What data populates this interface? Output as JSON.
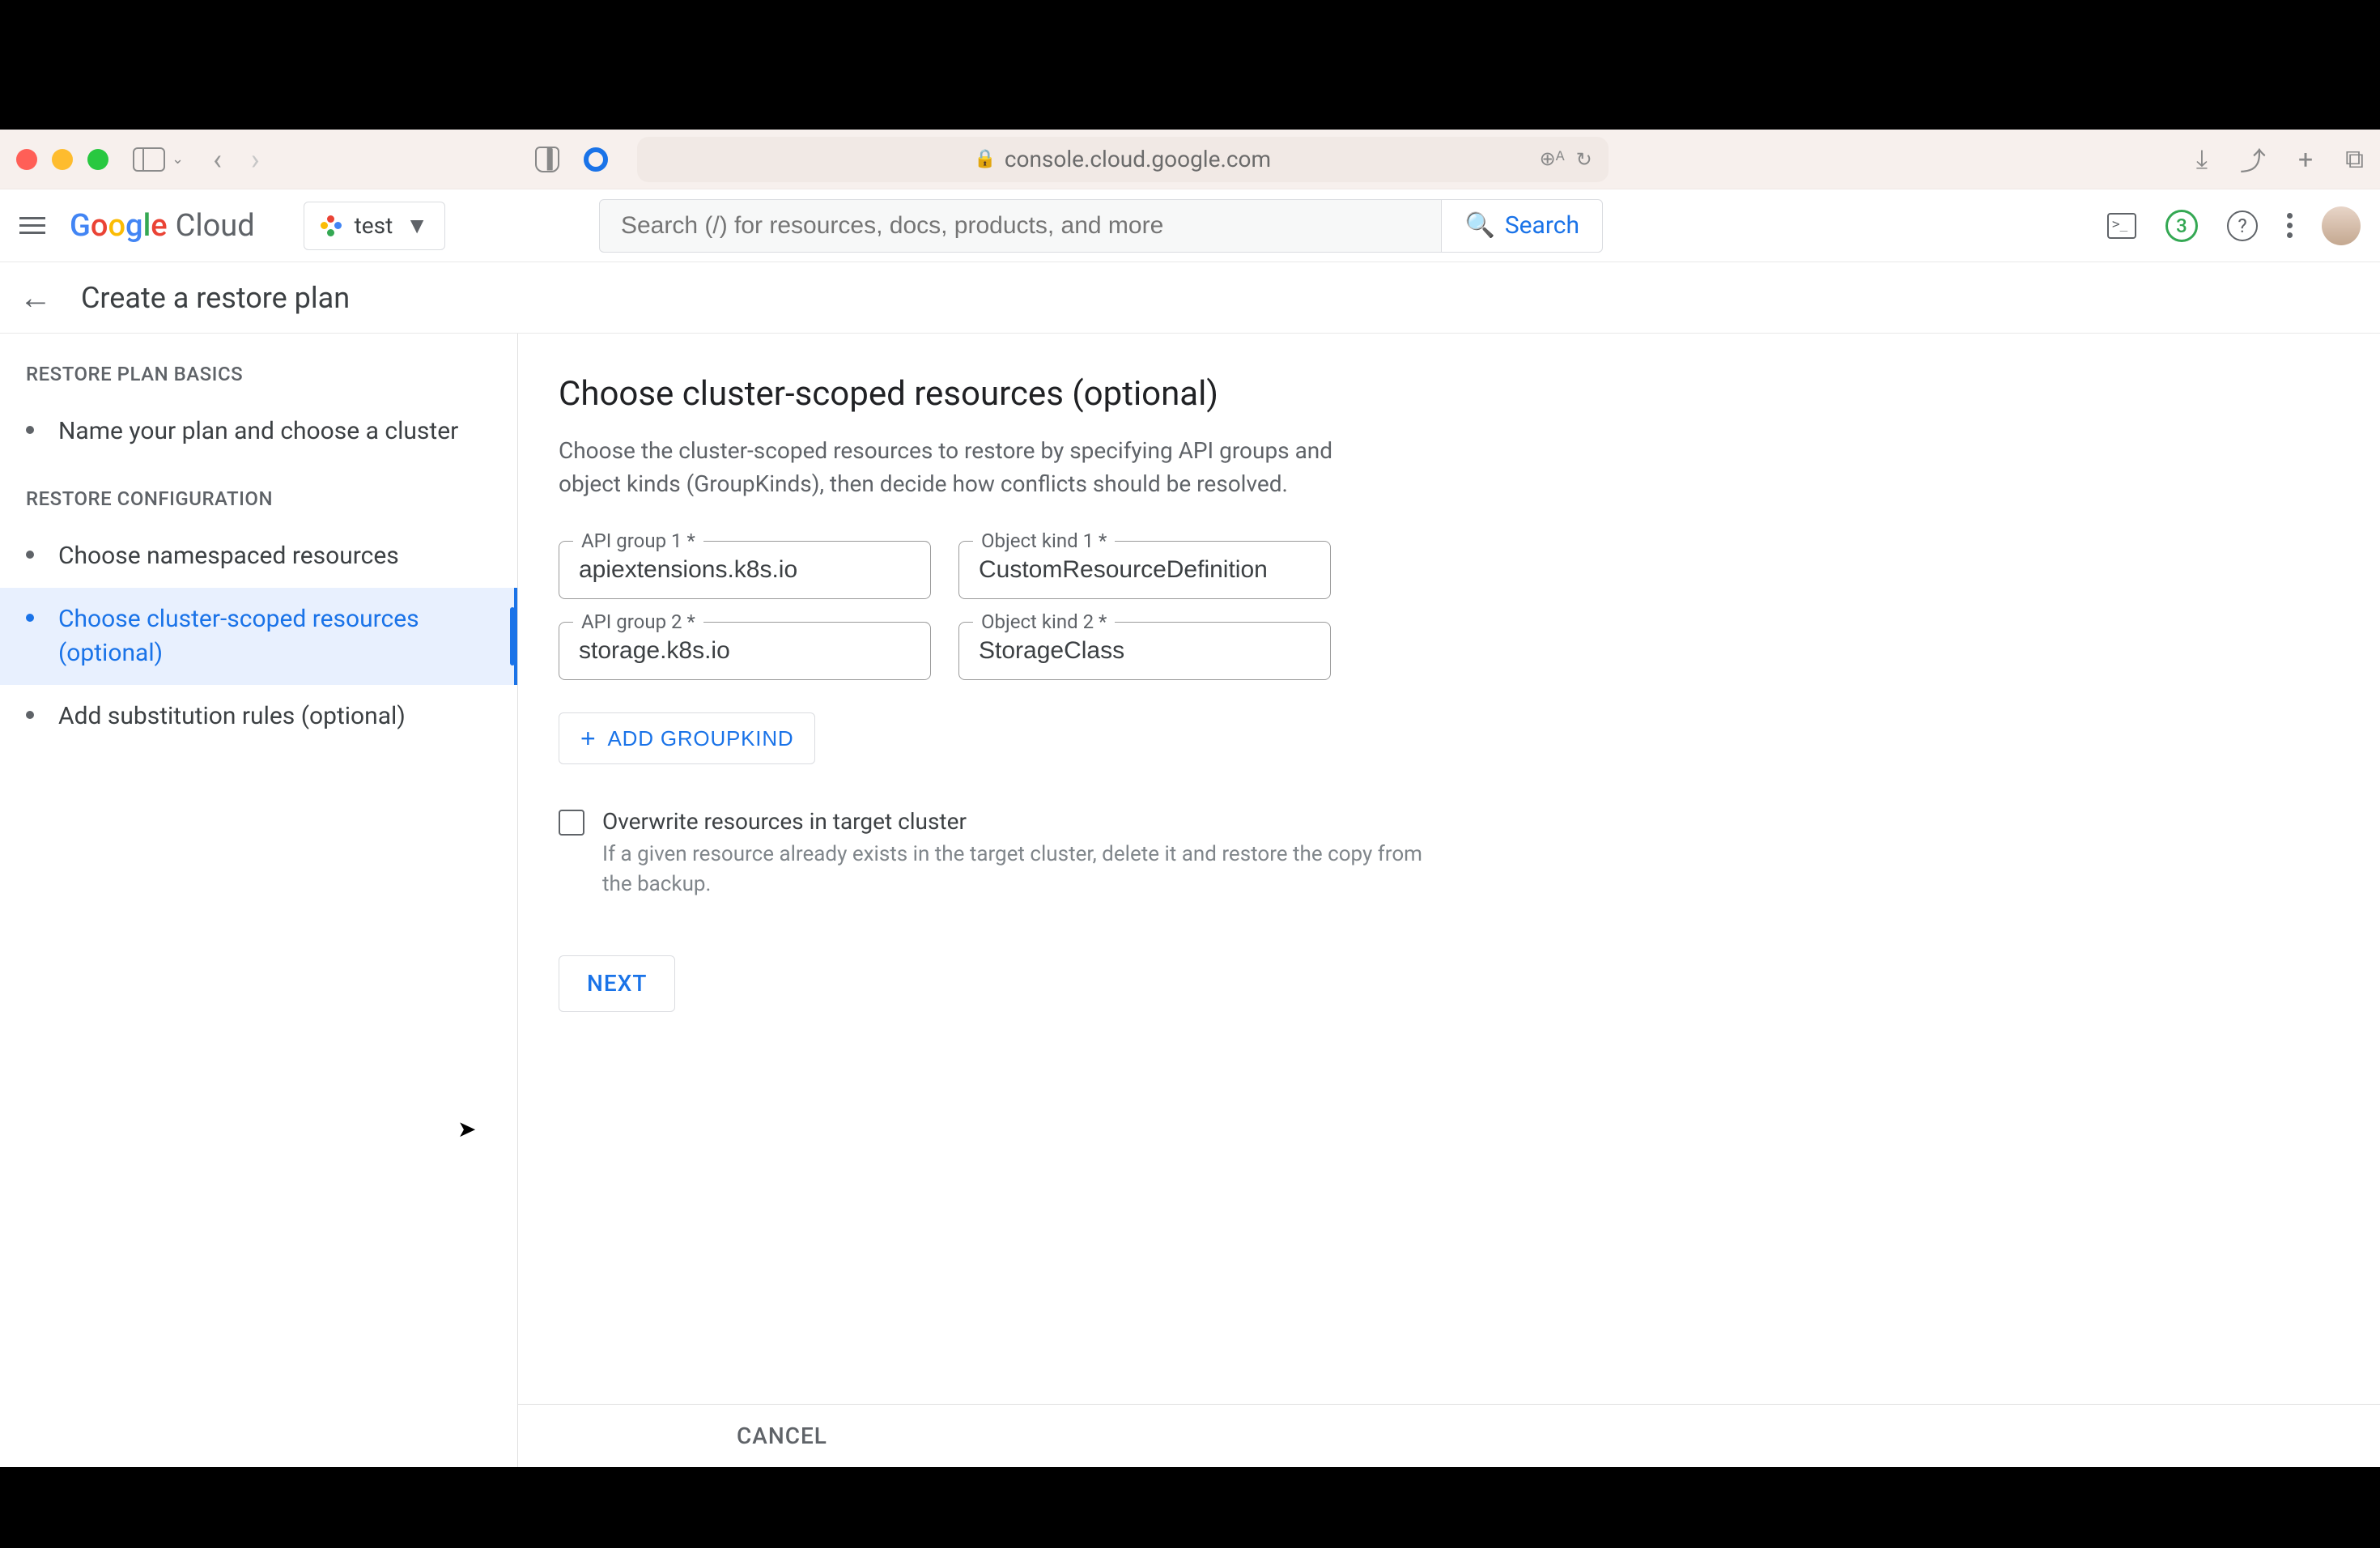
{
  "browser": {
    "url": "console.cloud.google.com"
  },
  "header": {
    "logo_text": "Google Cloud",
    "project": "test",
    "search_placeholder": "Search (/) for resources, docs, products, and more",
    "search_btn": "Search",
    "badge": "3"
  },
  "subheader": {
    "title": "Create a restore plan"
  },
  "sidebar": {
    "section1": "RESTORE PLAN BASICS",
    "section2": "RESTORE CONFIGURATION",
    "items": [
      "Name your plan and choose a cluster",
      "Choose namespaced resources",
      "Choose cluster-scoped resources (optional)",
      "Add substitution rules (optional)"
    ]
  },
  "main": {
    "heading": "Choose cluster-scoped resources (optional)",
    "description": "Choose the cluster-scoped resources to restore by specifying API groups and object kinds (GroupKinds), then decide how conflicts should be resolved.",
    "fields": {
      "api1_label": "API group 1 *",
      "api1_value": "apiextensions.k8s.io",
      "kind1_label": "Object kind 1 *",
      "kind1_value": "CustomResourceDefinition",
      "api2_label": "API group 2 *",
      "api2_value": "storage.k8s.io",
      "kind2_label": "Object kind 2 *",
      "kind2_value": "StorageClass"
    },
    "add_btn": "ADD GROUPKIND",
    "checkbox": {
      "label": "Overwrite resources in target cluster",
      "help": "If a given resource already exists in the target cluster, delete it and restore the copy from the backup."
    },
    "next_btn": "NEXT",
    "cancel_btn": "CANCEL"
  }
}
